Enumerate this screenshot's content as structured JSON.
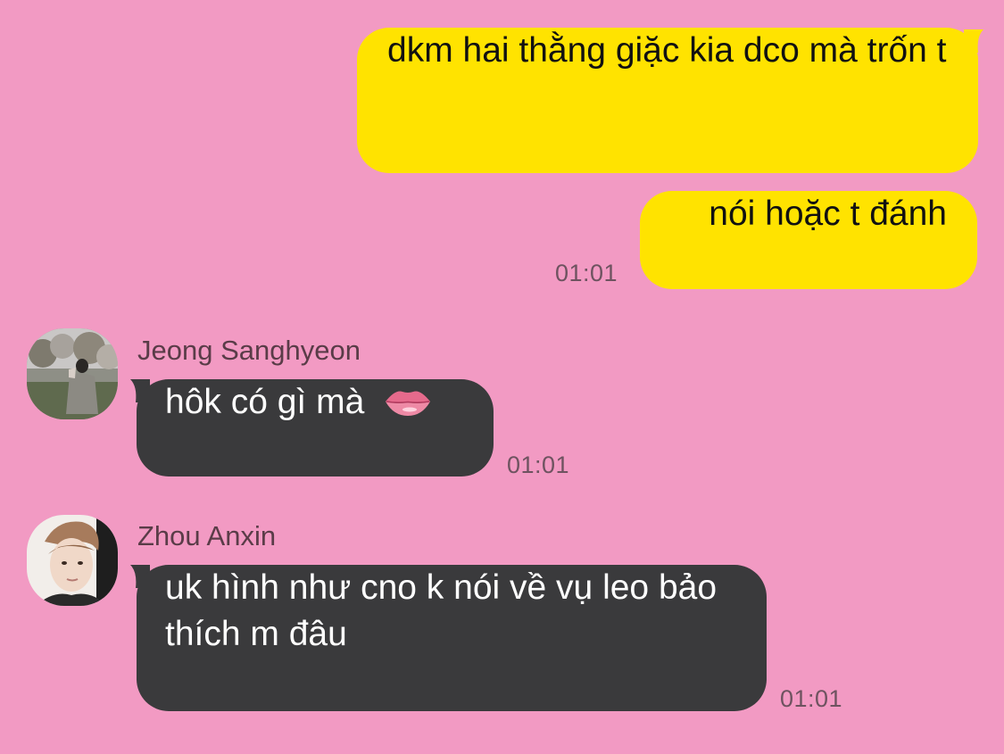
{
  "theme": {
    "background": "#F29AC3",
    "outgoing_bubble": "#FFE300",
    "incoming_bubble": "#3A3A3C"
  },
  "messages": [
    {
      "direction": "outgoing",
      "text": "dkm hai thằng giặc kia dco mà trốn t",
      "time": ""
    },
    {
      "direction": "outgoing",
      "text": "nói hoặc t đánh",
      "time": "01:01"
    },
    {
      "direction": "incoming",
      "sender": "Jeong Sanghyeon",
      "avatar_icon": "avatar-photo-man-in-blossom-trees",
      "text": "hôk có gì mà",
      "emoji": "lips-emoji",
      "time": "01:01"
    },
    {
      "direction": "incoming",
      "sender": "Zhou Anxin",
      "avatar_icon": "avatar-photo-man-portrait",
      "text": "uk hình như cno k nói về vụ leo bảo thích m đâu",
      "time": "01:01"
    }
  ]
}
